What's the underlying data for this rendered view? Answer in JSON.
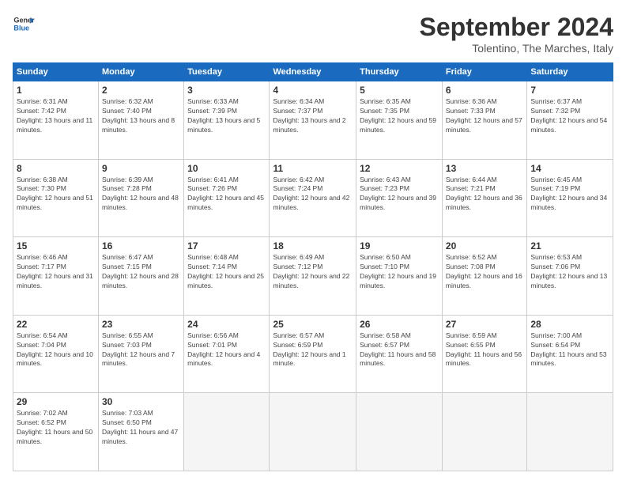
{
  "logo": {
    "line1": "General",
    "line2": "Blue"
  },
  "title": "September 2024",
  "location": "Tolentino, The Marches, Italy",
  "header_days": [
    "Sunday",
    "Monday",
    "Tuesday",
    "Wednesday",
    "Thursday",
    "Friday",
    "Saturday"
  ],
  "weeks": [
    [
      {
        "day": "1",
        "sunrise": "6:31 AM",
        "sunset": "7:42 PM",
        "daylight": "13 hours and 11 minutes."
      },
      {
        "day": "2",
        "sunrise": "6:32 AM",
        "sunset": "7:40 PM",
        "daylight": "13 hours and 8 minutes."
      },
      {
        "day": "3",
        "sunrise": "6:33 AM",
        "sunset": "7:39 PM",
        "daylight": "13 hours and 5 minutes."
      },
      {
        "day": "4",
        "sunrise": "6:34 AM",
        "sunset": "7:37 PM",
        "daylight": "13 hours and 2 minutes."
      },
      {
        "day": "5",
        "sunrise": "6:35 AM",
        "sunset": "7:35 PM",
        "daylight": "12 hours and 59 minutes."
      },
      {
        "day": "6",
        "sunrise": "6:36 AM",
        "sunset": "7:33 PM",
        "daylight": "12 hours and 57 minutes."
      },
      {
        "day": "7",
        "sunrise": "6:37 AM",
        "sunset": "7:32 PM",
        "daylight": "12 hours and 54 minutes."
      }
    ],
    [
      {
        "day": "8",
        "sunrise": "6:38 AM",
        "sunset": "7:30 PM",
        "daylight": "12 hours and 51 minutes."
      },
      {
        "day": "9",
        "sunrise": "6:39 AM",
        "sunset": "7:28 PM",
        "daylight": "12 hours and 48 minutes."
      },
      {
        "day": "10",
        "sunrise": "6:41 AM",
        "sunset": "7:26 PM",
        "daylight": "12 hours and 45 minutes."
      },
      {
        "day": "11",
        "sunrise": "6:42 AM",
        "sunset": "7:24 PM",
        "daylight": "12 hours and 42 minutes."
      },
      {
        "day": "12",
        "sunrise": "6:43 AM",
        "sunset": "7:23 PM",
        "daylight": "12 hours and 39 minutes."
      },
      {
        "day": "13",
        "sunrise": "6:44 AM",
        "sunset": "7:21 PM",
        "daylight": "12 hours and 36 minutes."
      },
      {
        "day": "14",
        "sunrise": "6:45 AM",
        "sunset": "7:19 PM",
        "daylight": "12 hours and 34 minutes."
      }
    ],
    [
      {
        "day": "15",
        "sunrise": "6:46 AM",
        "sunset": "7:17 PM",
        "daylight": "12 hours and 31 minutes."
      },
      {
        "day": "16",
        "sunrise": "6:47 AM",
        "sunset": "7:15 PM",
        "daylight": "12 hours and 28 minutes."
      },
      {
        "day": "17",
        "sunrise": "6:48 AM",
        "sunset": "7:14 PM",
        "daylight": "12 hours and 25 minutes."
      },
      {
        "day": "18",
        "sunrise": "6:49 AM",
        "sunset": "7:12 PM",
        "daylight": "12 hours and 22 minutes."
      },
      {
        "day": "19",
        "sunrise": "6:50 AM",
        "sunset": "7:10 PM",
        "daylight": "12 hours and 19 minutes."
      },
      {
        "day": "20",
        "sunrise": "6:52 AM",
        "sunset": "7:08 PM",
        "daylight": "12 hours and 16 minutes."
      },
      {
        "day": "21",
        "sunrise": "6:53 AM",
        "sunset": "7:06 PM",
        "daylight": "12 hours and 13 minutes."
      }
    ],
    [
      {
        "day": "22",
        "sunrise": "6:54 AM",
        "sunset": "7:04 PM",
        "daylight": "12 hours and 10 minutes."
      },
      {
        "day": "23",
        "sunrise": "6:55 AM",
        "sunset": "7:03 PM",
        "daylight": "12 hours and 7 minutes."
      },
      {
        "day": "24",
        "sunrise": "6:56 AM",
        "sunset": "7:01 PM",
        "daylight": "12 hours and 4 minutes."
      },
      {
        "day": "25",
        "sunrise": "6:57 AM",
        "sunset": "6:59 PM",
        "daylight": "12 hours and 1 minute."
      },
      {
        "day": "26",
        "sunrise": "6:58 AM",
        "sunset": "6:57 PM",
        "daylight": "11 hours and 58 minutes."
      },
      {
        "day": "27",
        "sunrise": "6:59 AM",
        "sunset": "6:55 PM",
        "daylight": "11 hours and 56 minutes."
      },
      {
        "day": "28",
        "sunrise": "7:00 AM",
        "sunset": "6:54 PM",
        "daylight": "11 hours and 53 minutes."
      }
    ],
    [
      {
        "day": "29",
        "sunrise": "7:02 AM",
        "sunset": "6:52 PM",
        "daylight": "11 hours and 50 minutes."
      },
      {
        "day": "30",
        "sunrise": "7:03 AM",
        "sunset": "6:50 PM",
        "daylight": "11 hours and 47 minutes."
      },
      null,
      null,
      null,
      null,
      null
    ]
  ]
}
